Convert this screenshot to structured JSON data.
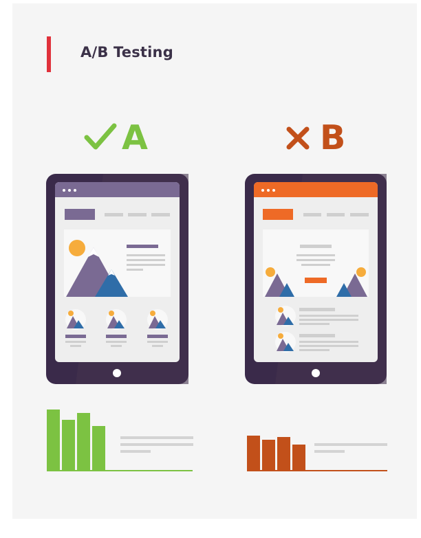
{
  "page": {
    "title": "A/B Testing"
  },
  "variants": [
    {
      "letter": "A",
      "status": "winner",
      "icon": "check-icon",
      "color": "#7cc242",
      "accent": "#7a6a93"
    },
    {
      "letter": "B",
      "status": "loser",
      "icon": "x-icon",
      "color": "#c2501a",
      "accent": "#ee6a26"
    }
  ],
  "colors": {
    "title_accent": "#e0313b",
    "tablet_body": "#3a2a4a",
    "screen_bg": "#eeeeee",
    "placeholder_gray": "#cfcfcf",
    "mountain_purple": "#7a6a93",
    "mountain_blue": "#2f6da8",
    "sun": "#f6ac3c"
  },
  "charts": [
    {
      "variant": "A",
      "values": [
        88,
        73,
        83,
        64
      ],
      "color": "#7cc242"
    },
    {
      "variant": "B",
      "values": [
        50,
        44,
        48,
        37
      ],
      "color": "#c2501a"
    }
  ]
}
